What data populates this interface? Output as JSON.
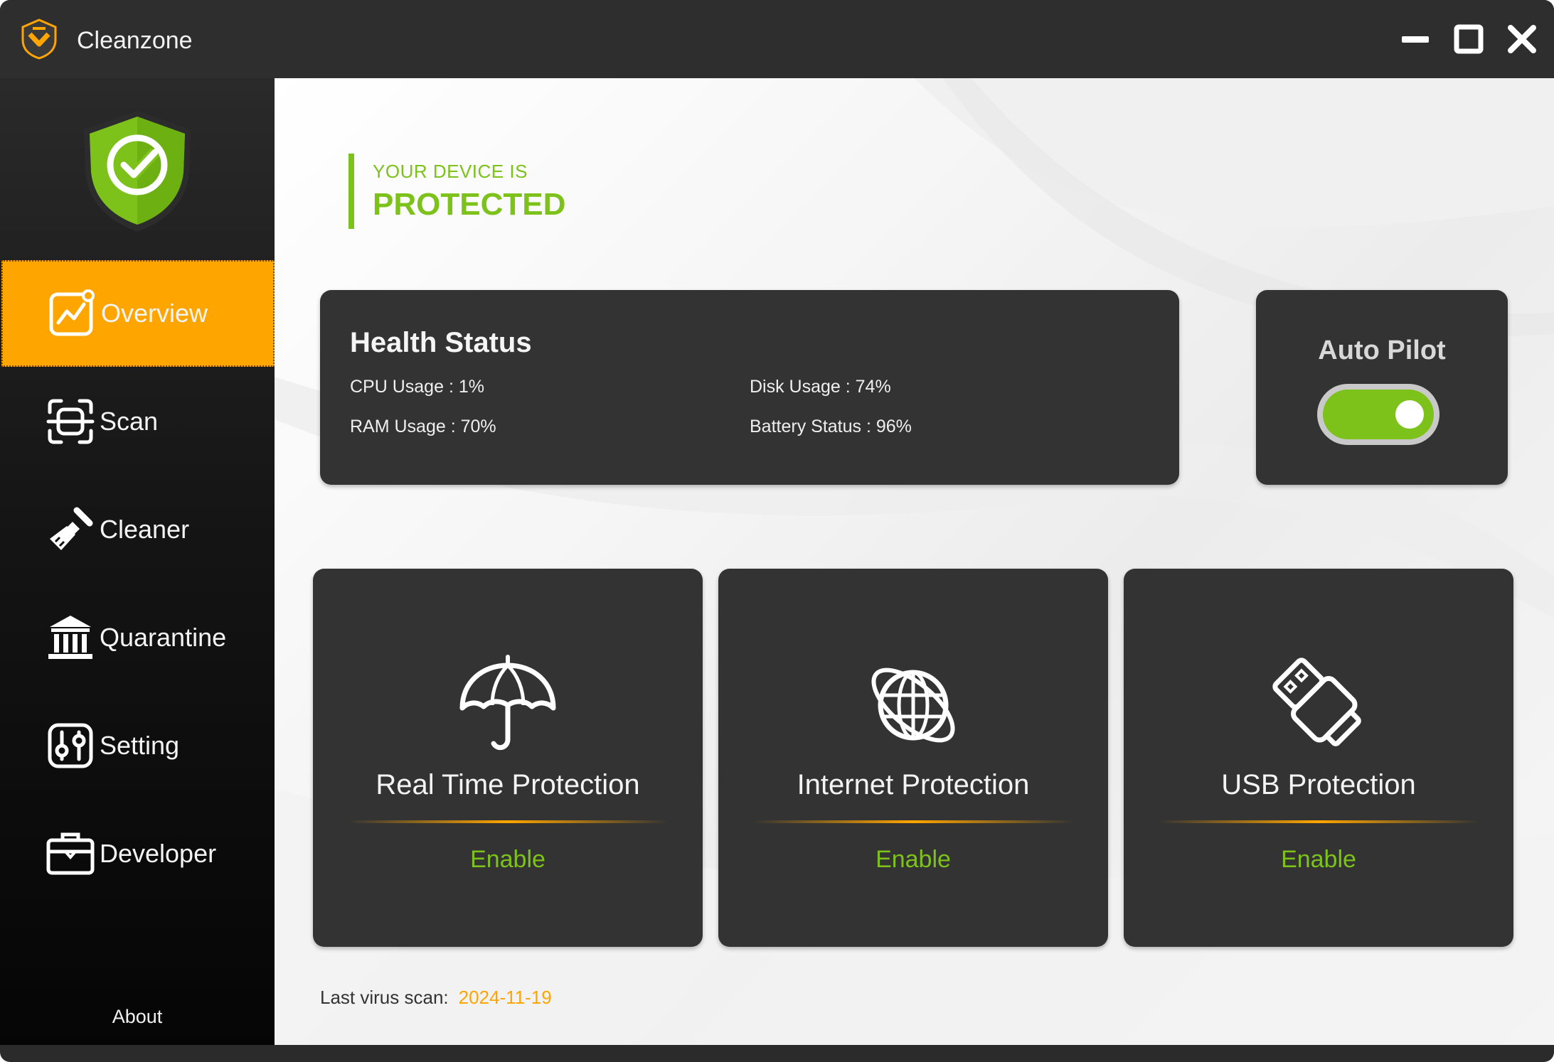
{
  "window": {
    "title": "Cleanzone",
    "accent": "#ffa500",
    "success": "#7cc21a"
  },
  "titlebar": {
    "logo_icon": "app-logo-icon",
    "buttons": [
      "minimize-icon",
      "maximize-icon",
      "close-icon"
    ]
  },
  "sidebar": {
    "logo_icon": "shield-check-icon",
    "items": [
      {
        "label": "Overview",
        "icon": "chart-icon",
        "active": true
      },
      {
        "label": "Scan",
        "icon": "scan-icon",
        "active": false
      },
      {
        "label": "Cleaner",
        "icon": "brush-icon",
        "active": false
      },
      {
        "label": "Quarantine",
        "icon": "bank-icon",
        "active": false
      },
      {
        "label": "Setting",
        "icon": "sliders-icon",
        "active": false
      },
      {
        "label": "Developer",
        "icon": "briefcase-icon",
        "active": false
      }
    ],
    "about_label": "About"
  },
  "status": {
    "subtitle": "YOUR DEVICE IS",
    "title": "PROTECTED"
  },
  "health": {
    "title": "Health Status",
    "cpu": "CPU Usage : 1%",
    "ram": "RAM Usage : 70%",
    "disk": "Disk Usage : 74%",
    "battery": "Battery Status : 96%"
  },
  "autopilot": {
    "title": "Auto Pilot",
    "enabled": true
  },
  "protections": [
    {
      "title": "Real Time Protection",
      "action": "Enable",
      "icon": "umbrella-icon"
    },
    {
      "title": "Internet Protection",
      "action": "Enable",
      "icon": "globe-icon"
    },
    {
      "title": "USB Protection",
      "action": "Enable",
      "icon": "usb-icon"
    }
  ],
  "last_scan": {
    "label": "Last virus scan:",
    "date": "2024-11-19"
  }
}
